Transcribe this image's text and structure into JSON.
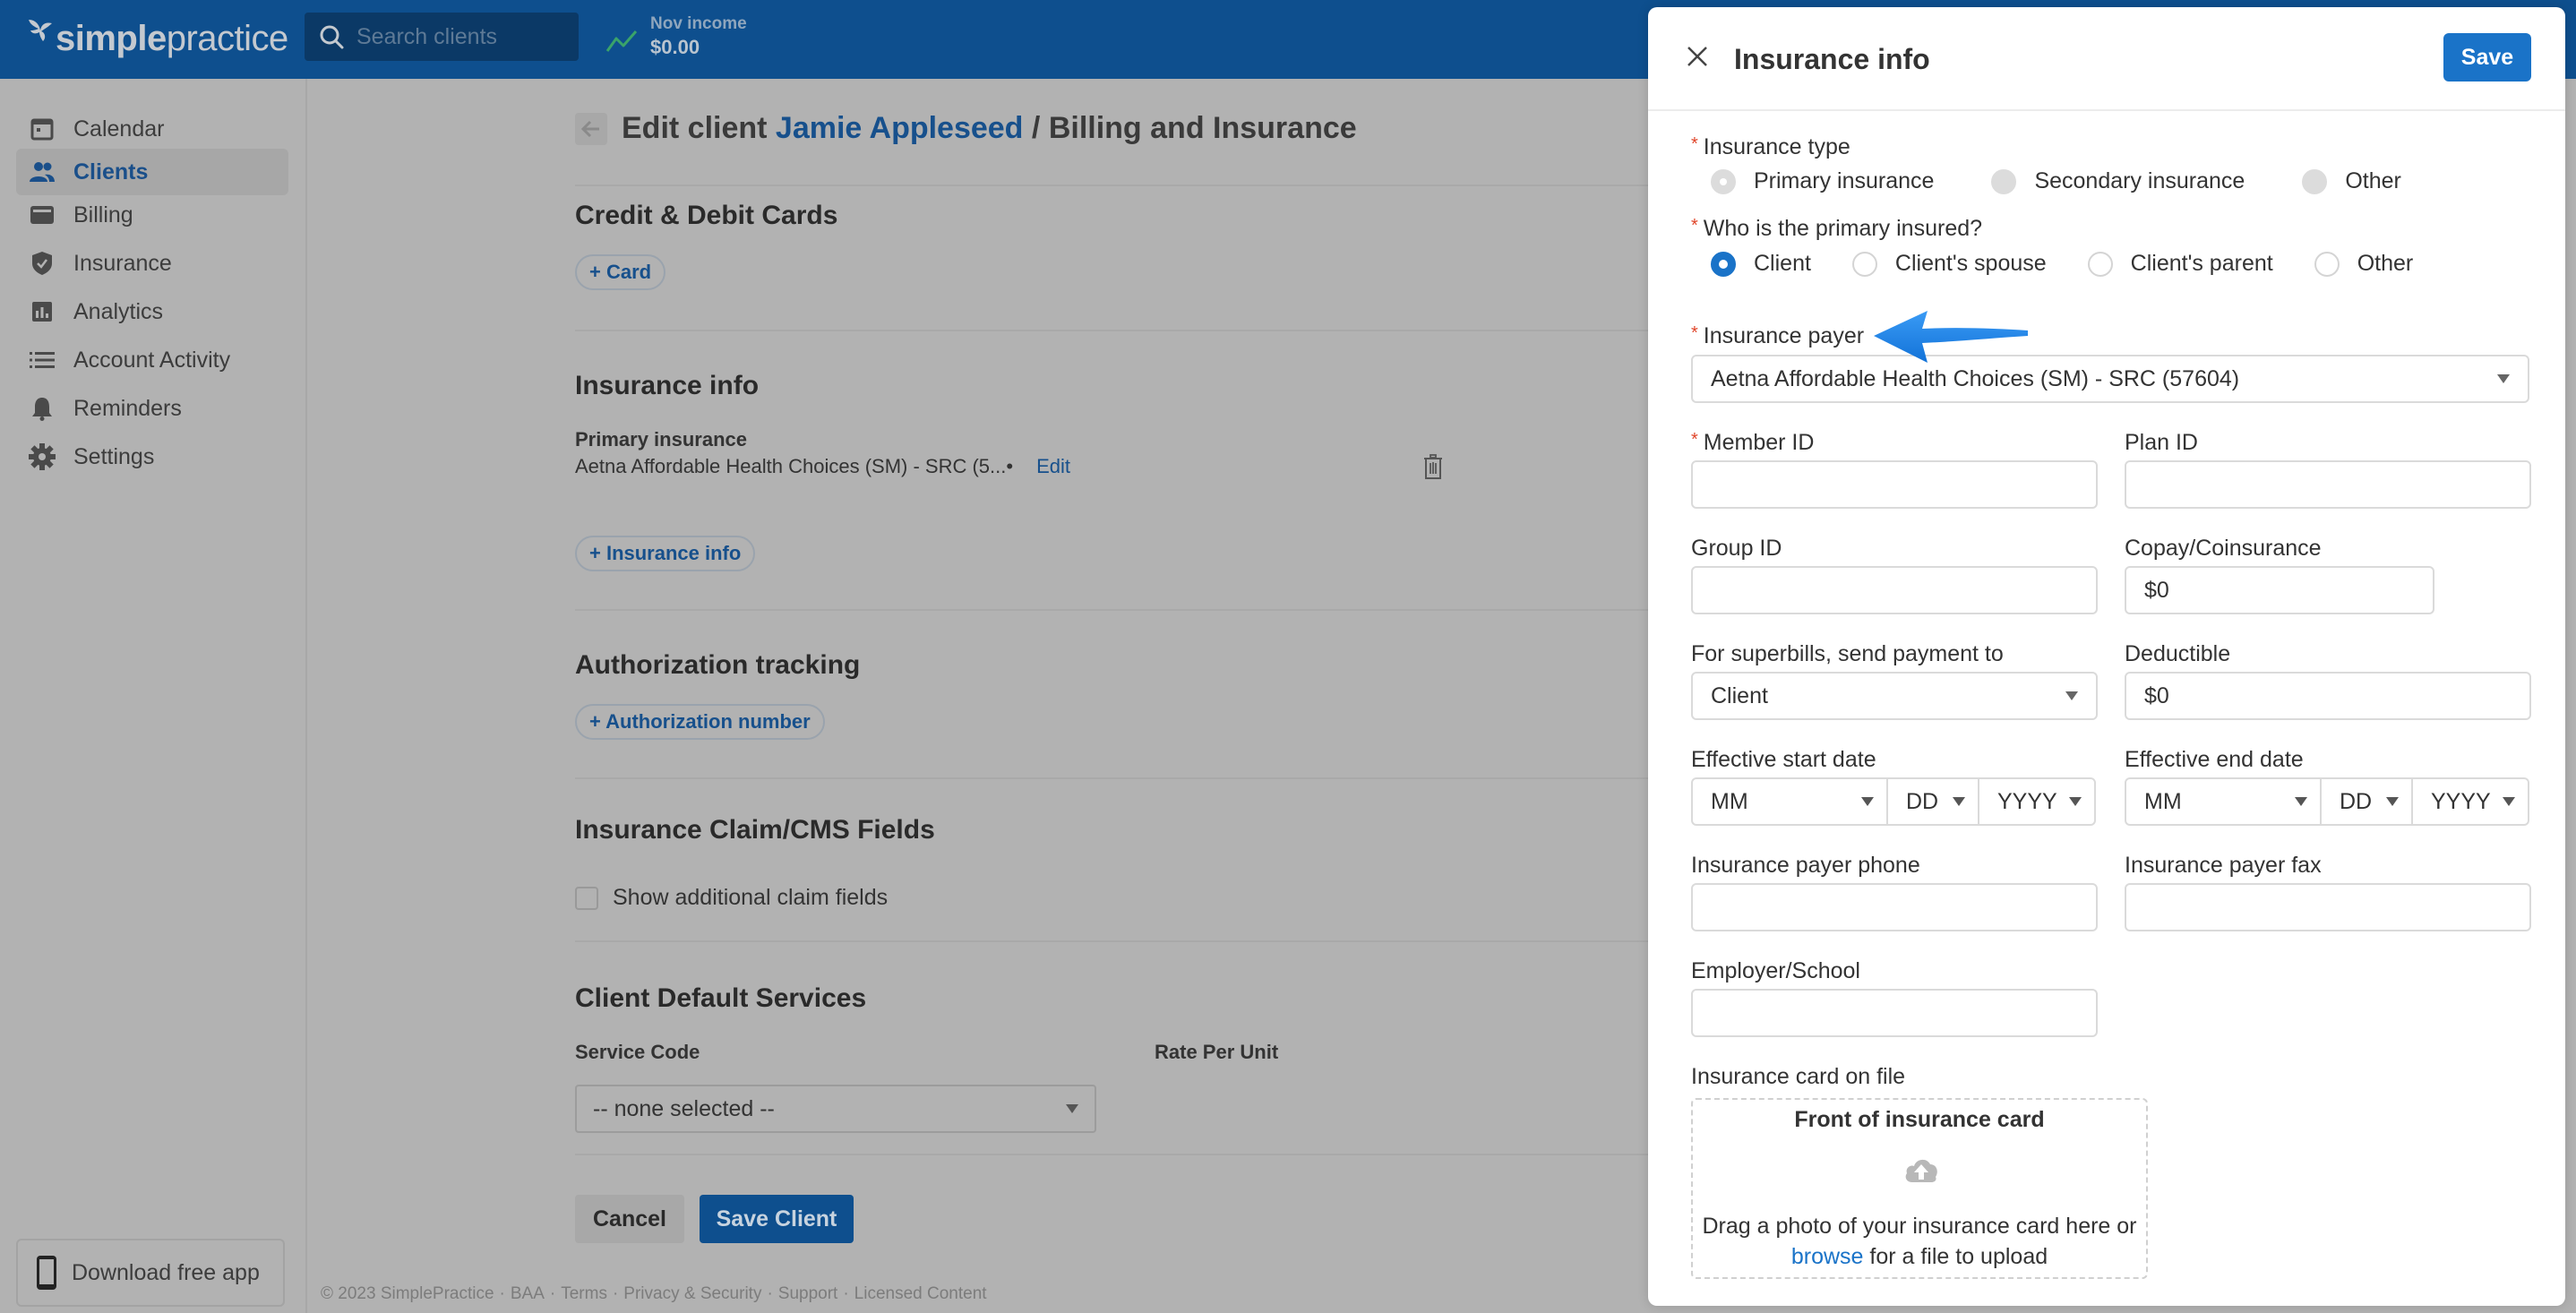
{
  "header": {
    "logo_bold": "simple",
    "logo_light": "practice",
    "search_placeholder": "Search clients",
    "income_label": "Nov income",
    "income_value": "$0.00"
  },
  "sidebar": {
    "items": [
      {
        "label": "Calendar",
        "icon": "calendar-icon",
        "active": false
      },
      {
        "label": "Clients",
        "icon": "clients-icon",
        "active": true
      },
      {
        "label": "Billing",
        "icon": "credit-card-icon",
        "active": false
      },
      {
        "label": "Insurance",
        "icon": "shield-check-icon",
        "active": false
      },
      {
        "label": "Analytics",
        "icon": "bar-chart-icon",
        "active": false
      },
      {
        "label": "Account Activity",
        "icon": "list-icon",
        "active": false
      },
      {
        "label": "Reminders",
        "icon": "bell-icon",
        "active": false
      },
      {
        "label": "Settings",
        "icon": "gear-icon",
        "active": false
      }
    ],
    "download_app": "Download free app"
  },
  "main": {
    "title_prefix": "Edit client",
    "client_name": "Jamie Appleseed",
    "title_separator": "/",
    "title_suffix": "Billing and Insurance",
    "cards_section": {
      "heading": "Credit & Debit Cards",
      "add_button": "+ Card"
    },
    "insurance_section": {
      "heading": "Insurance info",
      "primary_label": "Primary insurance",
      "primary_value": "Aetna Affordable Health Choices (SM) - SRC (5...",
      "bullet": "•",
      "edit_link": "Edit",
      "add_button": "+ Insurance info"
    },
    "authorization_section": {
      "heading": "Authorization tracking",
      "add_button": "+ Authorization number"
    },
    "claim_section": {
      "heading": "Insurance Claim/CMS Fields",
      "checkbox_label": "Show additional claim fields",
      "checked": false
    },
    "services_section": {
      "heading": "Client Default Services",
      "col_service_code": "Service Code",
      "col_rate_per_unit": "Rate Per Unit",
      "service_select_value": "-- none selected --"
    },
    "cancel_button": "Cancel",
    "save_client_button": "Save Client",
    "footer_links": [
      "© 2023 SimplePractice",
      "BAA",
      "Terms",
      "Privacy & Security",
      "Support",
      "Licensed Content"
    ],
    "footer_separator": "·"
  },
  "drawer": {
    "title": "Insurance info",
    "save_button": "Save",
    "insurance_type": {
      "label": "Insurance type",
      "required": "*",
      "options": [
        "Primary insurance",
        "Secondary insurance",
        "Other"
      ],
      "selected": "Primary insurance",
      "disabled": true
    },
    "primary_insured": {
      "label": "Who is the primary insured?",
      "required": "*",
      "options": [
        "Client",
        "Client's spouse",
        "Client's parent",
        "Other"
      ],
      "selected": "Client"
    },
    "insurance_payer": {
      "label": "Insurance payer",
      "required": "*",
      "value": "Aetna Affordable Health Choices (SM) - SRC (57604)"
    },
    "member_id": {
      "label": "Member ID",
      "required": "*",
      "value": ""
    },
    "plan_id": {
      "label": "Plan ID",
      "value": ""
    },
    "group_id": {
      "label": "Group ID",
      "value": ""
    },
    "copay": {
      "label": "Copay/Coinsurance",
      "value": "$0"
    },
    "superbills": {
      "label": "For superbills, send payment to",
      "value": "Client"
    },
    "deductible": {
      "label": "Deductible",
      "value": "$0"
    },
    "effective_start": {
      "label": "Effective start date",
      "mm": "MM",
      "dd": "DD",
      "yyyy": "YYYY"
    },
    "effective_end": {
      "label": "Effective end date",
      "mm": "MM",
      "dd": "DD",
      "yyyy": "YYYY"
    },
    "payer_phone": {
      "label": "Insurance payer phone",
      "value": ""
    },
    "payer_fax": {
      "label": "Insurance payer fax",
      "value": ""
    },
    "employer": {
      "label": "Employer/School",
      "value": ""
    },
    "card_on_file": {
      "label": "Insurance card on file",
      "title": "Front of insurance card",
      "text_before": "Drag a photo of your insurance card here or",
      "browse_link": "browse",
      "text_after": "for a file to upload"
    }
  },
  "annotation": {
    "arrow_color": "#1e88f0",
    "points_to": "Insurance payer"
  },
  "colors": {
    "brand_header": "#0e4f8e",
    "link": "#17508c",
    "primary_button": "#1a73c8",
    "required": "#e0452a"
  }
}
